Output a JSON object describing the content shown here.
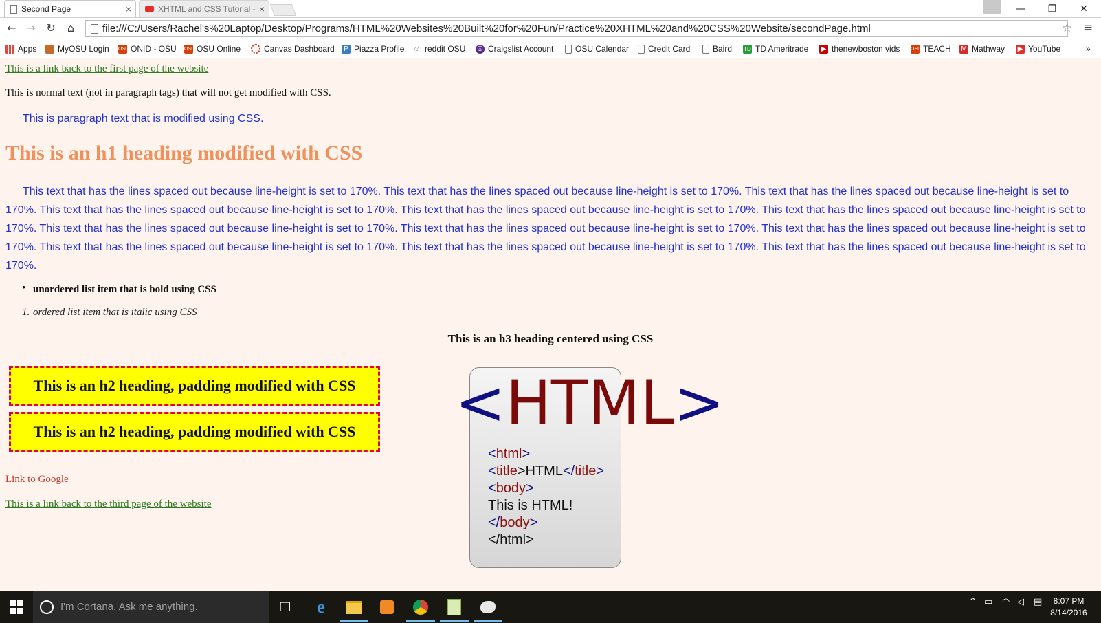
{
  "browser": {
    "tabs": [
      {
        "label": "Second Page",
        "active": true
      },
      {
        "label": "XHTML and CSS Tutorial -",
        "active": false
      }
    ],
    "address": "file:///C:/Users/Rachel's%20Laptop/Desktop/Programs/HTML%20Websites%20Built%20for%20Fun/Practice%20XHTML%20and%20CSS%20Website/secondPage.html",
    "bookmarks": [
      {
        "label": "Apps",
        "icon": "apps-grid-icon"
      },
      {
        "label": "MyOSU Login",
        "icon": "myosu-icon"
      },
      {
        "label": "ONID - OSU",
        "icon": "osu-icon"
      },
      {
        "label": "OSU Online",
        "icon": "osu-icon"
      },
      {
        "label": "Canvas Dashboard",
        "icon": "canvas-icon"
      },
      {
        "label": "Piazza Profile",
        "icon": "piazza-icon"
      },
      {
        "label": "reddit OSU",
        "icon": "reddit-icon"
      },
      {
        "label": "Craigslist Account",
        "icon": "peace-icon"
      },
      {
        "label": "OSU Calendar",
        "icon": "page-icon"
      },
      {
        "label": "Credit Card",
        "icon": "page-icon"
      },
      {
        "label": "Baird",
        "icon": "page-icon"
      },
      {
        "label": "TD Ameritrade",
        "icon": "td-icon"
      },
      {
        "label": "thenewboston vids",
        "icon": "thenewboston-icon"
      },
      {
        "label": "TEACH",
        "icon": "osu-coe-icon"
      },
      {
        "label": "Mathway",
        "icon": "mathway-icon"
      },
      {
        "label": "YouTube",
        "icon": "youtube-icon"
      }
    ],
    "bookmarks_overflow": "»"
  },
  "page": {
    "link_first": "This is a link back to the first page of the website",
    "normal_text": "This is normal text (not in paragraph tags) that will not get modified with CSS.",
    "paragraph": "This is paragraph text that is modified using CSS.",
    "h1": "This is an h1 heading modified with CSS",
    "spaced_paragraph": "This text that has the lines spaced out because line-height is set to 170%. This text that has the lines spaced out because line-height is set to 170%. This text that has the lines spaced out because line-height is set to 170%. This text that has the lines spaced out because line-height is set to 170%. This text that has the lines spaced out because line-height is set to 170%. This text that has the lines spaced out because line-height is set to 170%. This text that has the lines spaced out because line-height is set to 170%. This text that has the lines spaced out because line-height is set to 170%. This text that has the lines spaced out because line-height is set to 170%. This text that has the lines spaced out because line-height is set to 170%. This text that has the lines spaced out because line-height is set to 170%. This text that has the lines spaced out because line-height is set to 170%.",
    "ul_item": "unordered list item that is bold using CSS",
    "ol_marker": "1.",
    "ol_item": "ordered list item that is italic using CSS",
    "h3": "This is an h3 heading centered using CSS",
    "h2_first": "This is an h2 heading, padding modified with CSS",
    "h2_second": "This is an h2 heading, padding modified with CSS",
    "link_google": "Link to Google",
    "link_third": "This is a link back to the third page of the website",
    "html_image": {
      "logo_open": "<",
      "logo_word": "HTML",
      "logo_close": ">",
      "code_lines": [
        {
          "parts": [
            {
              "t": "<",
              "c": "b"
            },
            {
              "t": "html",
              "c": "t"
            },
            {
              "t": ">",
              "c": "b"
            }
          ]
        },
        {
          "parts": [
            {
              "t": "<",
              "c": "b"
            },
            {
              "t": "title",
              "c": "t"
            },
            {
              "t": ">HTML",
              "c": "n"
            },
            {
              "t": "</",
              "c": "b"
            },
            {
              "t": "title",
              "c": "t"
            },
            {
              "t": ">",
              "c": "b"
            }
          ]
        },
        {
          "parts": [
            {
              "t": "<",
              "c": "b"
            },
            {
              "t": "body",
              "c": "t"
            },
            {
              "t": ">",
              "c": "b"
            }
          ]
        },
        {
          "parts": [
            {
              "t": "This is HTML!",
              "c": "n"
            }
          ]
        },
        {
          "parts": [
            {
              "t": "</",
              "c": "b"
            },
            {
              "t": "body",
              "c": "t"
            },
            {
              "t": ">",
              "c": "b"
            }
          ]
        },
        {
          "parts": [
            {
              "t": "</",
              "c": "n"
            },
            {
              "t": "html",
              "c": "n"
            },
            {
              "t": ">",
              "c": "n"
            }
          ]
        }
      ]
    }
  },
  "taskbar": {
    "search_placeholder": "I'm Cortana. Ask me anything.",
    "time": "8:07 PM",
    "date": "8/14/2016"
  },
  "colors": {
    "page_bg": "#fff3ee",
    "link_green": "#2b7a1f",
    "link_red": "#c0392b",
    "paragraph_blue": "#2233cc",
    "h1_orange": "#f0905a",
    "h2_bg": "#ffff00",
    "h2_border": "#e0004a"
  }
}
